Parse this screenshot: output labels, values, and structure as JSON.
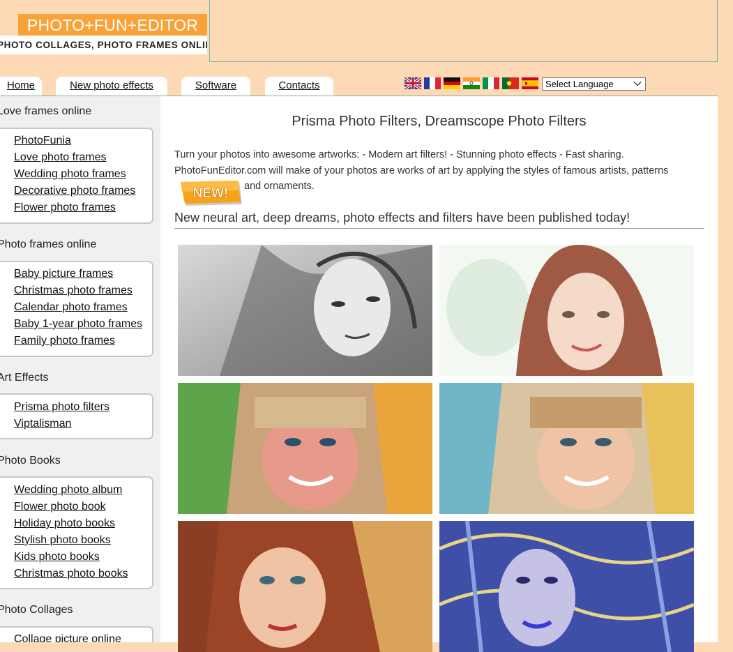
{
  "logo": {
    "line1": "PHOTO+FUN+EDITOR",
    "line2": "PHOTO COLLAGES, PHOTO FRAMES ONLINE"
  },
  "nav": {
    "tabs": [
      {
        "label": "Home"
      },
      {
        "label": "New photo effects"
      },
      {
        "label": "Software"
      },
      {
        "label": "Contacts"
      }
    ],
    "language": {
      "selected": "Select Language"
    },
    "flags": [
      "uk-flag-icon",
      "france-flag-icon",
      "germany-flag-icon",
      "india-flag-icon",
      "italy-flag-icon",
      "portugal-flag-icon",
      "spain-flag-icon"
    ]
  },
  "sidebar": {
    "sections": [
      {
        "title": "Love frames online",
        "items": [
          "PhotoFunia",
          "Love photo frames",
          "Wedding photo frames",
          "Decorative photo frames",
          "Flower photo frames"
        ]
      },
      {
        "title": "Photo frames online",
        "items": [
          "Baby picture frames",
          "Christmas photo frames",
          "Calendar photo frames",
          "Baby 1-year photo frames",
          "Family photo frames"
        ]
      },
      {
        "title": "Art Effects",
        "items": [
          "Prisma photo filters",
          "Viptalisman"
        ]
      },
      {
        "title": "Photo Books",
        "items": [
          "Wedding photo album",
          "Flower photo book",
          "Holiday photo books",
          "Stylish photo books",
          "Kids photo books",
          "Christmas photo books"
        ]
      },
      {
        "title": "Photo Collages",
        "items": [
          "Collage picture online"
        ]
      }
    ]
  },
  "main": {
    "title": "Prisma Photo Filters, Dreamscope Photo Filters",
    "intro_line1": "Turn your photos into awesome artworks: - Modern art filters! - Stunning photo effects - Fast sharing.",
    "intro_line2": "PhotoFunEditor.com will make of your photos are works of art by applying the styles of famous artists, patterns",
    "intro_line3": "and ornaments.",
    "new_badge": "NEW!",
    "subheading": "New neural art, deep dreams, photo effects and filters have been published today!"
  },
  "colors": {
    "logo_orange": "#f9a23a",
    "page_bg": "#fdd9b5",
    "sidebar_bg": "#f0f0f0",
    "badge": "#f7a21b"
  }
}
